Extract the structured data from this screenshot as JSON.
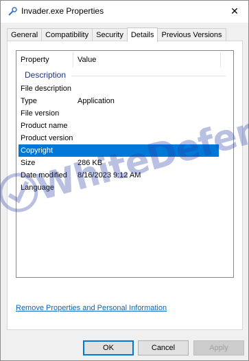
{
  "window": {
    "title": "Invader.exe Properties",
    "title_icon": "file-properties-icon",
    "close_glyph": "✕"
  },
  "tabs": [
    {
      "label": "General",
      "active": false
    },
    {
      "label": "Compatibility",
      "active": false
    },
    {
      "label": "Security",
      "active": false
    },
    {
      "label": "Details",
      "active": true
    },
    {
      "label": "Previous Versions",
      "active": false
    }
  ],
  "details": {
    "columns": {
      "property": "Property",
      "value": "Value"
    },
    "group": "Description",
    "rows": [
      {
        "property": "File description",
        "value": ""
      },
      {
        "property": "Type",
        "value": "Application"
      },
      {
        "property": "File version",
        "value": ""
      },
      {
        "property": "Product name",
        "value": ""
      },
      {
        "property": "Product version",
        "value": ""
      },
      {
        "property": "Copyright",
        "value": "",
        "selected": true
      },
      {
        "property": "Size",
        "value": "286 KB"
      },
      {
        "property": "Date modified",
        "value": "8/16/2023 9:12 AM"
      },
      {
        "property": "Language",
        "value": ""
      }
    ]
  },
  "link": {
    "remove": "Remove Properties and Personal Information"
  },
  "buttons": {
    "ok": "OK",
    "cancel": "Cancel",
    "apply": "Apply"
  },
  "watermark": {
    "text": "WhiteDefender"
  },
  "colors": {
    "selection": "#0078d7",
    "link": "#0066cc",
    "group_heading": "#1e3287",
    "watermark": "#2a3fa8"
  }
}
